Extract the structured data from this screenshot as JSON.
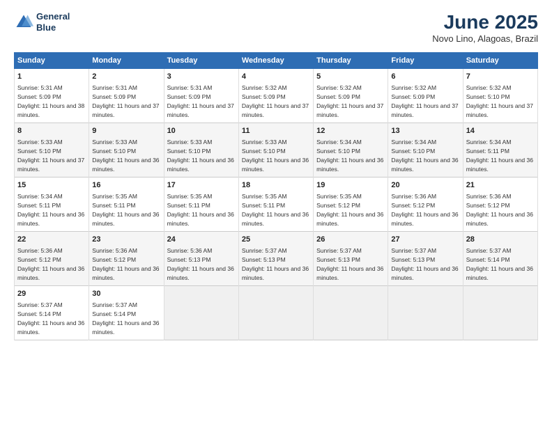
{
  "header": {
    "logo_line1": "General",
    "logo_line2": "Blue",
    "month": "June 2025",
    "location": "Novo Lino, Alagoas, Brazil"
  },
  "days_of_week": [
    "Sunday",
    "Monday",
    "Tuesday",
    "Wednesday",
    "Thursday",
    "Friday",
    "Saturday"
  ],
  "weeks": [
    [
      {
        "num": "1",
        "rise": "5:31 AM",
        "set": "5:09 PM",
        "daylight": "11 hours and 38 minutes"
      },
      {
        "num": "2",
        "rise": "5:31 AM",
        "set": "5:09 PM",
        "daylight": "11 hours and 37 minutes"
      },
      {
        "num": "3",
        "rise": "5:31 AM",
        "set": "5:09 PM",
        "daylight": "11 hours and 37 minutes"
      },
      {
        "num": "4",
        "rise": "5:32 AM",
        "set": "5:09 PM",
        "daylight": "11 hours and 37 minutes"
      },
      {
        "num": "5",
        "rise": "5:32 AM",
        "set": "5:09 PM",
        "daylight": "11 hours and 37 minutes"
      },
      {
        "num": "6",
        "rise": "5:32 AM",
        "set": "5:09 PM",
        "daylight": "11 hours and 37 minutes"
      },
      {
        "num": "7",
        "rise": "5:32 AM",
        "set": "5:10 PM",
        "daylight": "11 hours and 37 minutes"
      }
    ],
    [
      {
        "num": "8",
        "rise": "5:33 AM",
        "set": "5:10 PM",
        "daylight": "11 hours and 37 minutes"
      },
      {
        "num": "9",
        "rise": "5:33 AM",
        "set": "5:10 PM",
        "daylight": "11 hours and 36 minutes"
      },
      {
        "num": "10",
        "rise": "5:33 AM",
        "set": "5:10 PM",
        "daylight": "11 hours and 36 minutes"
      },
      {
        "num": "11",
        "rise": "5:33 AM",
        "set": "5:10 PM",
        "daylight": "11 hours and 36 minutes"
      },
      {
        "num": "12",
        "rise": "5:34 AM",
        "set": "5:10 PM",
        "daylight": "11 hours and 36 minutes"
      },
      {
        "num": "13",
        "rise": "5:34 AM",
        "set": "5:10 PM",
        "daylight": "11 hours and 36 minutes"
      },
      {
        "num": "14",
        "rise": "5:34 AM",
        "set": "5:11 PM",
        "daylight": "11 hours and 36 minutes"
      }
    ],
    [
      {
        "num": "15",
        "rise": "5:34 AM",
        "set": "5:11 PM",
        "daylight": "11 hours and 36 minutes"
      },
      {
        "num": "16",
        "rise": "5:35 AM",
        "set": "5:11 PM",
        "daylight": "11 hours and 36 minutes"
      },
      {
        "num": "17",
        "rise": "5:35 AM",
        "set": "5:11 PM",
        "daylight": "11 hours and 36 minutes"
      },
      {
        "num": "18",
        "rise": "5:35 AM",
        "set": "5:11 PM",
        "daylight": "11 hours and 36 minutes"
      },
      {
        "num": "19",
        "rise": "5:35 AM",
        "set": "5:12 PM",
        "daylight": "11 hours and 36 minutes"
      },
      {
        "num": "20",
        "rise": "5:36 AM",
        "set": "5:12 PM",
        "daylight": "11 hours and 36 minutes"
      },
      {
        "num": "21",
        "rise": "5:36 AM",
        "set": "5:12 PM",
        "daylight": "11 hours and 36 minutes"
      }
    ],
    [
      {
        "num": "22",
        "rise": "5:36 AM",
        "set": "5:12 PM",
        "daylight": "11 hours and 36 minutes"
      },
      {
        "num": "23",
        "rise": "5:36 AM",
        "set": "5:12 PM",
        "daylight": "11 hours and 36 minutes"
      },
      {
        "num": "24",
        "rise": "5:36 AM",
        "set": "5:13 PM",
        "daylight": "11 hours and 36 minutes"
      },
      {
        "num": "25",
        "rise": "5:37 AM",
        "set": "5:13 PM",
        "daylight": "11 hours and 36 minutes"
      },
      {
        "num": "26",
        "rise": "5:37 AM",
        "set": "5:13 PM",
        "daylight": "11 hours and 36 minutes"
      },
      {
        "num": "27",
        "rise": "5:37 AM",
        "set": "5:13 PM",
        "daylight": "11 hours and 36 minutes"
      },
      {
        "num": "28",
        "rise": "5:37 AM",
        "set": "5:14 PM",
        "daylight": "11 hours and 36 minutes"
      }
    ],
    [
      {
        "num": "29",
        "rise": "5:37 AM",
        "set": "5:14 PM",
        "daylight": "11 hours and 36 minutes"
      },
      {
        "num": "30",
        "rise": "5:37 AM",
        "set": "5:14 PM",
        "daylight": "11 hours and 36 minutes"
      },
      null,
      null,
      null,
      null,
      null
    ]
  ]
}
